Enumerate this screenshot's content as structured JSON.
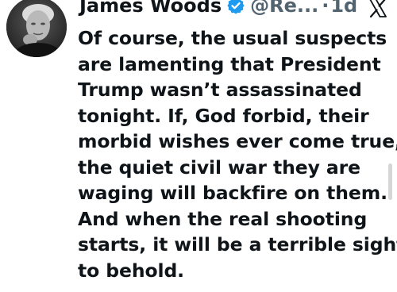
{
  "post": {
    "author_name": "James Woods",
    "handle": "@Re...",
    "separator": "·",
    "time": "1d",
    "verified": true,
    "text_lines": [
      "Of course, the usual suspects",
      "are lamenting that President",
      "Trump wasn’t assassinated",
      "tonight. If, God forbid, their",
      "morbid wishes ever come true,",
      "the quiet civil war they are",
      "waging will backfire on them.",
      "And when the real shooting",
      "starts, it will be a terrible sight",
      "to behold."
    ]
  },
  "icons": {
    "verified": "verified-badge-icon",
    "app": "x-logo-icon"
  },
  "colors": {
    "text": "#0f1419",
    "secondary_text": "#536471",
    "verified": "#1d9bf0",
    "background": "#ffffff"
  }
}
